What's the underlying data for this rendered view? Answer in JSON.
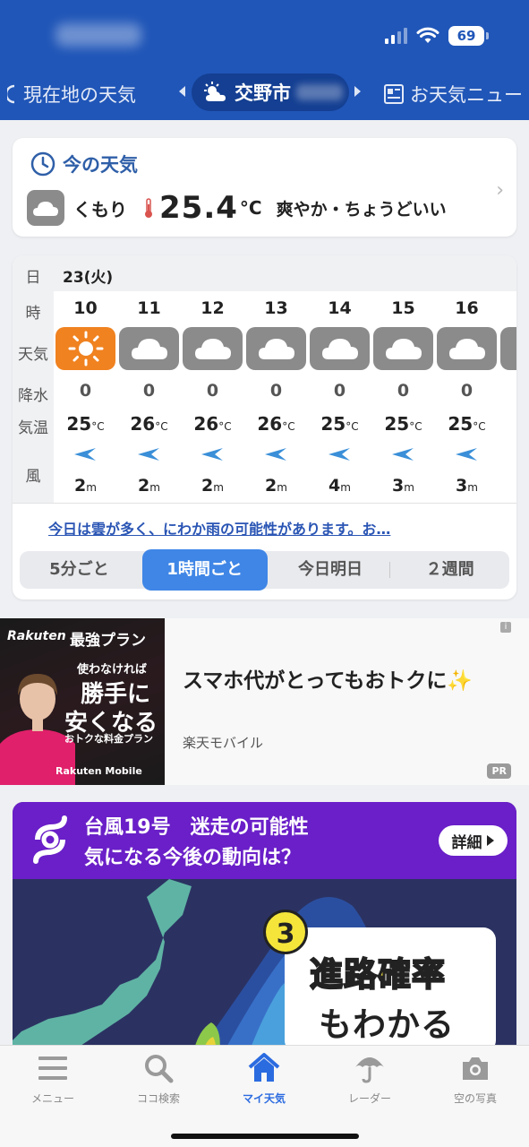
{
  "status_bar": {
    "battery": "69"
  },
  "header_tabs": {
    "left": "現在地の天気",
    "center": "交野市",
    "right": "お天気ニュー"
  },
  "current": {
    "title": "今の天気",
    "condition": "くもり",
    "temperature": "25.4",
    "unit": "°C",
    "description": "爽やか・ちょうどいい"
  },
  "hourly": {
    "labels": {
      "day": "日",
      "hour": "時",
      "weather": "天気",
      "precip": "降水",
      "temp": "気温",
      "wind": "風"
    },
    "date": "23(火)",
    "temp_unit": "°C",
    "wind_unit": "m",
    "columns": [
      {
        "hour": "10",
        "weather": "sunny",
        "precip": "0",
        "temp": "25",
        "wind": "2"
      },
      {
        "hour": "11",
        "weather": "cloudy",
        "precip": "0",
        "temp": "26",
        "wind": "2"
      },
      {
        "hour": "12",
        "weather": "cloudy",
        "precip": "0",
        "temp": "26",
        "wind": "2"
      },
      {
        "hour": "13",
        "weather": "cloudy",
        "precip": "0",
        "temp": "26",
        "wind": "2"
      },
      {
        "hour": "14",
        "weather": "cloudy",
        "precip": "0",
        "temp": "25",
        "wind": "4"
      },
      {
        "hour": "15",
        "weather": "cloudy",
        "precip": "0",
        "temp": "25",
        "wind": "3"
      },
      {
        "hour": "16",
        "weather": "cloudy",
        "precip": "0",
        "temp": "25",
        "wind": "3"
      }
    ],
    "forecast_text": "今日は雲が多く、にわか雨の可能性があります。お…",
    "segments": [
      "5分ごと",
      "1時間ごと",
      "今日明日",
      "２週間"
    ],
    "active_segment": "1時間ごと"
  },
  "ad": {
    "brand": "Rakuten",
    "plan": "最強プラン",
    "line1": "使わなければ",
    "line2": "勝手に",
    "line3": "安くなる",
    "line4": "おトクな料金プラン",
    "footer": "Rakuten Mobile",
    "headline": "スマホ代がとってもおトクに✨",
    "source": "楽天モバイル",
    "info": "i",
    "pr": "PR"
  },
  "typhoon": {
    "line1": "台風19号　迷走の可能性",
    "line2": "気になる今後の動向は？",
    "button": "詳細",
    "number": "3",
    "bubble1": "進路確率",
    "bubble2": "もわかる"
  },
  "bottom_nav": [
    {
      "label": "メニュー",
      "icon": "menu-icon"
    },
    {
      "label": "ココ検索",
      "icon": "search-icon"
    },
    {
      "label": "マイ天気",
      "icon": "home-icon"
    },
    {
      "label": "レーダー",
      "icon": "umbrella-icon"
    },
    {
      "label": "空の写真",
      "icon": "camera-icon"
    }
  ],
  "colors": {
    "header": "#2056b8",
    "accent": "#3f86e6",
    "sunny": "#f08220",
    "typhoon": "#6a1fc8"
  }
}
